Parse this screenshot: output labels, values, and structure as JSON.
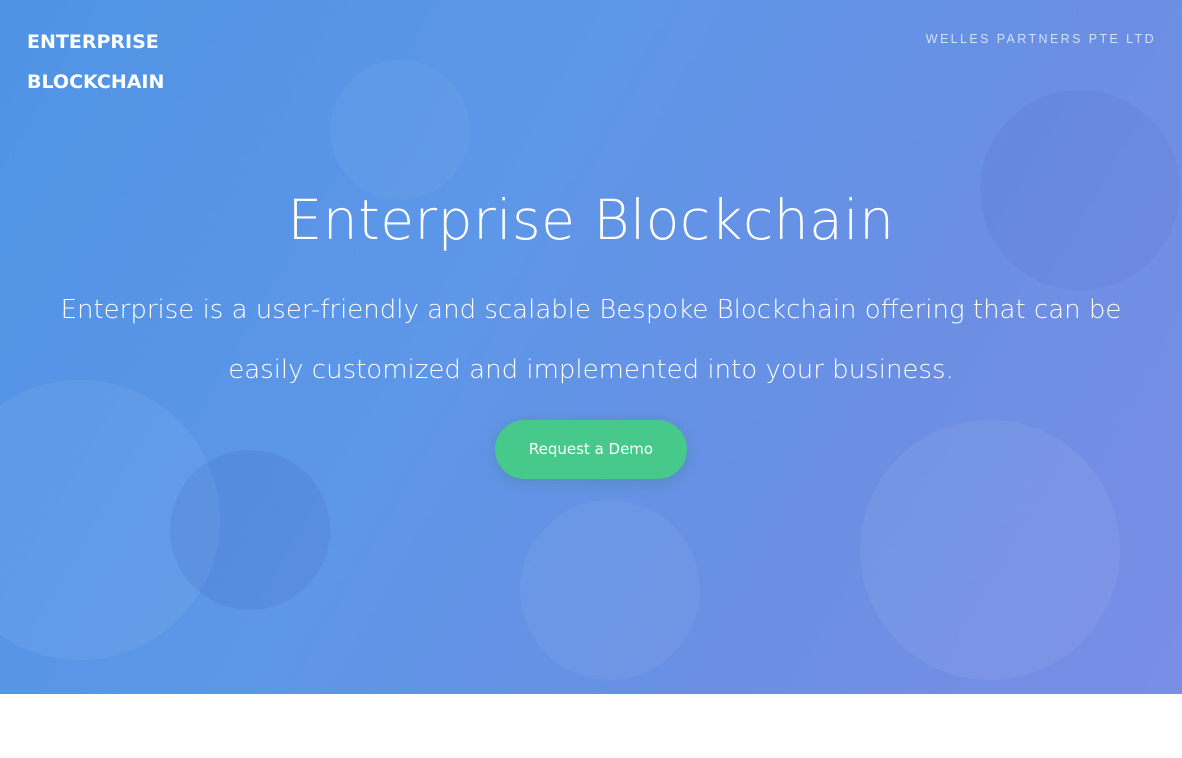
{
  "header": {
    "brand_line1": "ENTERPRISE",
    "brand_line2": "BLOCKCHAIN",
    "company": "WELLES PARTNERS PTE LTD"
  },
  "hero": {
    "title": "Enterprise Blockchain",
    "subtitle": "Enterprise is a user-friendly and scalable Bespoke Blockchain offering that can be easily customized and implemented into your business.",
    "cta_label": "Request a Demo"
  },
  "colors": {
    "hero_gradient_start": "#4f93e4",
    "hero_gradient_end": "#7a8ee6",
    "cta_background": "#47c98c",
    "text": "#ffffff",
    "below_fold_background": "#ffffff"
  }
}
